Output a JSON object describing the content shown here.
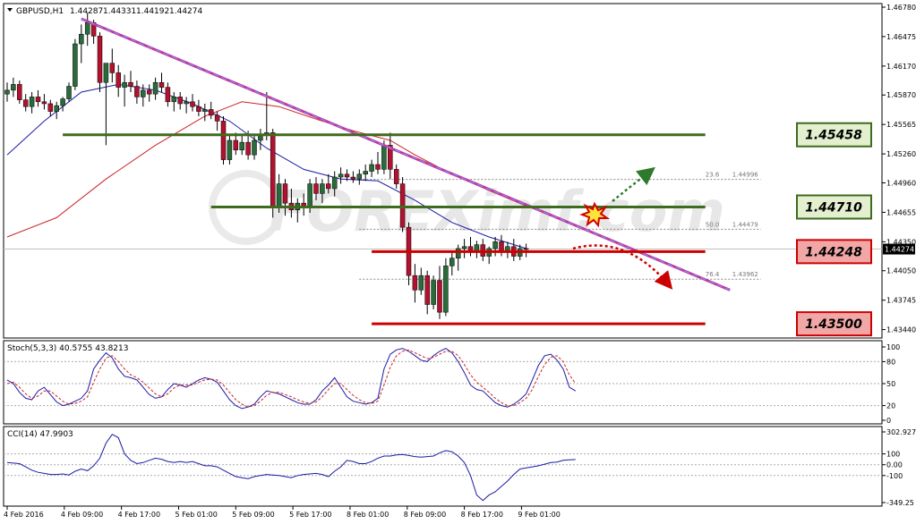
{
  "chart_data": [
    {
      "type": "candlestick",
      "header": {
        "symbol": "GBPUSD,H1",
        "open": "1.44287",
        "high": "1.44331",
        "low": "1.44192",
        "close": "1.44274"
      },
      "ylim": [
        1.4339,
        1.4678
      ],
      "y_ticks": [
        "1.46780",
        "1.46475",
        "1.46170",
        "1.45870",
        "1.45565",
        "1.45260",
        "1.44960",
        "1.44655",
        "1.44350",
        "1.44050",
        "1.43745",
        "1.43440"
      ],
      "current_price": "1.44274",
      "x_ticks": [
        "4 Feb 2016",
        "4 Feb 09:00",
        "4 Feb 17:00",
        "5 Feb 01:00",
        "5 Feb 09:00",
        "5 Feb 17:00",
        "8 Feb 01:00",
        "8 Feb 09:00",
        "8 Feb 17:00",
        "9 Feb 01:00"
      ],
      "candles": [
        [
          1.4588,
          1.46,
          1.458,
          1.4592
        ],
        [
          1.4592,
          1.4605,
          1.4585,
          1.4598
        ],
        [
          1.4598,
          1.4602,
          1.4578,
          1.4582
        ],
        [
          1.4582,
          1.4588,
          1.457,
          1.4575
        ],
        [
          1.4575,
          1.459,
          1.4568,
          1.4585
        ],
        [
          1.4585,
          1.4592,
          1.4575,
          1.458
        ],
        [
          1.458,
          1.4588,
          1.4572,
          1.4578
        ],
        [
          1.4578,
          1.4582,
          1.4565,
          1.457
        ],
        [
          1.457,
          1.458,
          1.4562,
          1.4576
        ],
        [
          1.4576,
          1.4585,
          1.457,
          1.4583
        ],
        [
          1.4583,
          1.46,
          1.458,
          1.4596
        ],
        [
          1.4596,
          1.4645,
          1.4592,
          1.464
        ],
        [
          1.464,
          1.466,
          1.462,
          1.465
        ],
        [
          1.465,
          1.4672,
          1.4638,
          1.4662
        ],
        [
          1.4662,
          1.4665,
          1.464,
          1.4648
        ],
        [
          1.4648,
          1.4652,
          1.459,
          1.46
        ],
        [
          1.46,
          1.4615,
          1.4535,
          1.462
        ],
        [
          1.462,
          1.4635,
          1.46,
          1.461
        ],
        [
          1.461,
          1.4618,
          1.4585,
          1.4595
        ],
        [
          1.4595,
          1.4608,
          1.4575,
          1.46
        ],
        [
          1.46,
          1.4612,
          1.459,
          1.4596
        ],
        [
          1.4596,
          1.4602,
          1.4578,
          1.4585
        ],
        [
          1.4585,
          1.4598,
          1.4575,
          1.4592
        ],
        [
          1.4592,
          1.4598,
          1.458,
          1.4588
        ],
        [
          1.4588,
          1.4605,
          1.4582,
          1.46
        ],
        [
          1.46,
          1.461,
          1.459,
          1.4595
        ],
        [
          1.4595,
          1.46,
          1.4575,
          1.458
        ],
        [
          1.458,
          1.459,
          1.457,
          1.4585
        ],
        [
          1.4585,
          1.459,
          1.4572,
          1.4578
        ],
        [
          1.4578,
          1.4585,
          1.4568,
          1.458
        ],
        [
          1.458,
          1.4588,
          1.457,
          1.4575
        ],
        [
          1.4575,
          1.4582,
          1.4565,
          1.457
        ],
        [
          1.457,
          1.4578,
          1.456,
          1.4572
        ],
        [
          1.4572,
          1.458,
          1.4562,
          1.4566
        ],
        [
          1.4566,
          1.457,
          1.455,
          1.456
        ],
        [
          1.456,
          1.4565,
          1.4515,
          1.452
        ],
        [
          1.452,
          1.4545,
          1.4515,
          1.454
        ],
        [
          1.454,
          1.4548,
          1.4525,
          1.453
        ],
        [
          1.453,
          1.4545,
          1.4525,
          1.4538
        ],
        [
          1.4538,
          1.455,
          1.452,
          1.4525
        ],
        [
          1.4525,
          1.4545,
          1.452,
          1.454
        ],
        [
          1.454,
          1.4552,
          1.453,
          1.4545
        ],
        [
          1.4545,
          1.459,
          1.454,
          1.4548
        ],
        [
          1.4548,
          1.4552,
          1.446,
          1.447
        ],
        [
          1.447,
          1.4505,
          1.4465,
          1.4495
        ],
        [
          1.4495,
          1.45,
          1.4462,
          1.4475
        ],
        [
          1.4475,
          1.449,
          1.446,
          1.4468
        ],
        [
          1.4468,
          1.448,
          1.4455,
          1.4475
        ],
        [
          1.4475,
          1.4485,
          1.4462,
          1.447
        ],
        [
          1.447,
          1.45,
          1.4465,
          1.4495
        ],
        [
          1.4495,
          1.4502,
          1.4478,
          1.4485
        ],
        [
          1.4485,
          1.45,
          1.4475,
          1.4495
        ],
        [
          1.4495,
          1.4505,
          1.4485,
          1.449
        ],
        [
          1.449,
          1.4508,
          1.4482,
          1.4502
        ],
        [
          1.4502,
          1.4512,
          1.4495,
          1.4505
        ],
        [
          1.4505,
          1.451,
          1.4498,
          1.4502
        ],
        [
          1.4502,
          1.4508,
          1.4496,
          1.45
        ],
        [
          1.45,
          1.451,
          1.4494,
          1.4505
        ],
        [
          1.4505,
          1.4515,
          1.4498,
          1.4508
        ],
        [
          1.4508,
          1.452,
          1.4502,
          1.4515
        ],
        [
          1.4515,
          1.4528,
          1.4505,
          1.451
        ],
        [
          1.451,
          1.454,
          1.4505,
          1.4535
        ],
        [
          1.4535,
          1.4548,
          1.45,
          1.451
        ],
        [
          1.451,
          1.4515,
          1.449,
          1.4495
        ],
        [
          1.4495,
          1.4502,
          1.4445,
          1.445
        ],
        [
          1.445,
          1.4455,
          1.439,
          1.44
        ],
        [
          1.44,
          1.4412,
          1.4372,
          1.4385
        ],
        [
          1.4385,
          1.4408,
          1.438,
          1.44
        ],
        [
          1.44,
          1.4405,
          1.436,
          1.437
        ],
        [
          1.437,
          1.44,
          1.4365,
          1.4395
        ],
        [
          1.4395,
          1.441,
          1.4355,
          1.4362
        ],
        [
          1.4362,
          1.4418,
          1.4358,
          1.441
        ],
        [
          1.441,
          1.4425,
          1.44,
          1.4418
        ],
        [
          1.4418,
          1.4432,
          1.4405,
          1.4428
        ],
        [
          1.4428,
          1.4438,
          1.4418,
          1.443
        ],
        [
          1.443,
          1.444,
          1.442,
          1.4425
        ],
        [
          1.4425,
          1.4436,
          1.4418,
          1.4432
        ],
        [
          1.4432,
          1.4438,
          1.4415,
          1.442
        ],
        [
          1.442,
          1.443,
          1.4412,
          1.4428
        ],
        [
          1.4428,
          1.444,
          1.442,
          1.4435
        ],
        [
          1.4435,
          1.4442,
          1.442,
          1.4425
        ],
        [
          1.4425,
          1.4435,
          1.4418,
          1.443
        ],
        [
          1.443,
          1.4438,
          1.4415,
          1.442
        ],
        [
          1.442,
          1.4432,
          1.4416,
          1.4428
        ],
        [
          1.4428,
          1.4433,
          1.4419,
          1.4427
        ]
      ],
      "moving_averages": [
        {
          "color": "#1a1aa6",
          "points": [
            [
              0,
              1.4525
            ],
            [
              6,
              1.456
            ],
            [
              12,
              1.459
            ],
            [
              18,
              1.4598
            ],
            [
              24,
              1.4592
            ],
            [
              30,
              1.4578
            ],
            [
              36,
              1.456
            ],
            [
              42,
              1.4532
            ],
            [
              48,
              1.451
            ],
            [
              54,
              1.45
            ],
            [
              60,
              1.4498
            ],
            [
              66,
              1.4478
            ],
            [
              72,
              1.4455
            ],
            [
              78,
              1.444
            ],
            [
              84,
              1.4428
            ]
          ]
        },
        {
          "color": "#cc2222",
          "points": [
            [
              0,
              1.444
            ],
            [
              8,
              1.446
            ],
            [
              16,
              1.45
            ],
            [
              24,
              1.4535
            ],
            [
              32,
              1.4565
            ],
            [
              38,
              1.458
            ],
            [
              44,
              1.4575
            ],
            [
              50,
              1.4562
            ],
            [
              56,
              1.455
            ],
            [
              62,
              1.454
            ],
            [
              66,
              1.4525
            ],
            [
              72,
              1.4505
            ],
            [
              78,
              1.4488
            ],
            [
              84,
              1.4472
            ]
          ]
        }
      ],
      "trendline": {
        "from": [
          12,
          1.4666
        ],
        "to": [
          117,
          1.4385
        ]
      },
      "levels": [
        {
          "value": 1.45458,
          "label": "1.45458",
          "color": "#3e6b1e",
          "from": 9,
          "to": 113
        },
        {
          "value": 1.4471,
          "label": "1.44710",
          "color": "#3e6b1e",
          "from": 33,
          "to": 113
        },
        {
          "value": 1.44248,
          "label": "1.44248",
          "color": "#cc0000",
          "from": 59,
          "to": 113
        },
        {
          "value": 1.435,
          "label": "1.43500",
          "color": "#cc0000",
          "from": 59,
          "to": 113
        }
      ],
      "fibonacci": [
        {
          "label": "23.6",
          "value": "1.44996",
          "price": 1.44996
        },
        {
          "label": "50.0",
          "value": "1.44479",
          "price": 1.44479
        },
        {
          "label": "76.4",
          "value": "1.43962",
          "price": 1.43962
        }
      ],
      "fib_range": {
        "from": 57,
        "to": 122
      },
      "watermark": "FOREXimf.com",
      "colors": {
        "bull": "#2a6b3a",
        "bear": "#b3112e",
        "grid": "#c8c8c8",
        "text": "#000000"
      }
    },
    {
      "type": "line",
      "name": "Stoch(5,3,3) 40.5755 43.8213",
      "ylim": [
        0,
        100
      ],
      "y_ticks": [
        "100",
        "80",
        "50",
        "20",
        "0"
      ],
      "series": [
        {
          "color": "#1a1aa6",
          "dash": false,
          "values": [
            55,
            50,
            38,
            30,
            28,
            40,
            45,
            35,
            25,
            20,
            22,
            26,
            30,
            40,
            70,
            82,
            92,
            85,
            70,
            60,
            58,
            55,
            45,
            35,
            30,
            32,
            42,
            50,
            48,
            45,
            50,
            55,
            58,
            56,
            52,
            40,
            28,
            20,
            16,
            18,
            22,
            32,
            40,
            38,
            36,
            32,
            28,
            24,
            22,
            22,
            28,
            40,
            48,
            58,
            45,
            32,
            26,
            24,
            22,
            24,
            30,
            70,
            90,
            96,
            98,
            94,
            88,
            82,
            80,
            88,
            94,
            98,
            92,
            80,
            65,
            48,
            42,
            40,
            32,
            24,
            20,
            18,
            22,
            28,
            36,
            55,
            75,
            88,
            90,
            82,
            70,
            45,
            40
          ]
        },
        {
          "color": "#cc2222",
          "dash": true,
          "values": [
            50,
            52,
            45,
            36,
            30,
            33,
            40,
            40,
            33,
            26,
            22,
            23,
            26,
            32,
            52,
            70,
            85,
            88,
            80,
            70,
            62,
            58,
            52,
            44,
            36,
            32,
            36,
            44,
            48,
            48,
            48,
            52,
            55,
            56,
            55,
            48,
            38,
            28,
            22,
            18,
            20,
            26,
            34,
            38,
            38,
            35,
            32,
            28,
            25,
            23,
            25,
            32,
            42,
            50,
            50,
            42,
            34,
            28,
            24,
            23,
            26,
            48,
            72,
            88,
            94,
            96,
            92,
            88,
            84,
            86,
            90,
            94,
            94,
            88,
            76,
            62,
            52,
            45,
            38,
            30,
            24,
            20,
            20,
            24,
            30,
            42,
            60,
            76,
            86,
            88,
            80,
            62,
            50
          ]
        }
      ]
    },
    {
      "type": "line",
      "name": "CCI(14) 47.9903",
      "y_ticks": [
        "302.927",
        "100",
        "0.00",
        "-100",
        "-349.25"
      ],
      "ylim": [
        -349.25,
        302.927
      ],
      "series": [
        {
          "color": "#1a1aa6",
          "dash": false,
          "values": [
            20,
            15,
            10,
            -20,
            -50,
            -70,
            -80,
            -90,
            -90,
            -85,
            -95,
            -60,
            -40,
            -55,
            -10,
            60,
            200,
            280,
            250,
            100,
            40,
            10,
            20,
            40,
            60,
            50,
            30,
            20,
            30,
            20,
            30,
            10,
            -10,
            -10,
            -20,
            -50,
            -80,
            -110,
            -120,
            -130,
            -110,
            -100,
            -90,
            -95,
            -100,
            -110,
            -120,
            -100,
            -90,
            -85,
            -80,
            -90,
            -110,
            -60,
            -20,
            40,
            30,
            10,
            10,
            30,
            60,
            80,
            80,
            90,
            95,
            85,
            75,
            70,
            75,
            80,
            110,
            130,
            120,
            80,
            20,
            -100,
            -280,
            -330,
            -280,
            -250,
            -200,
            -150,
            -90,
            -40,
            -30,
            -20,
            -10,
            5,
            20,
            25,
            40,
            45,
            48
          ]
        }
      ]
    }
  ]
}
